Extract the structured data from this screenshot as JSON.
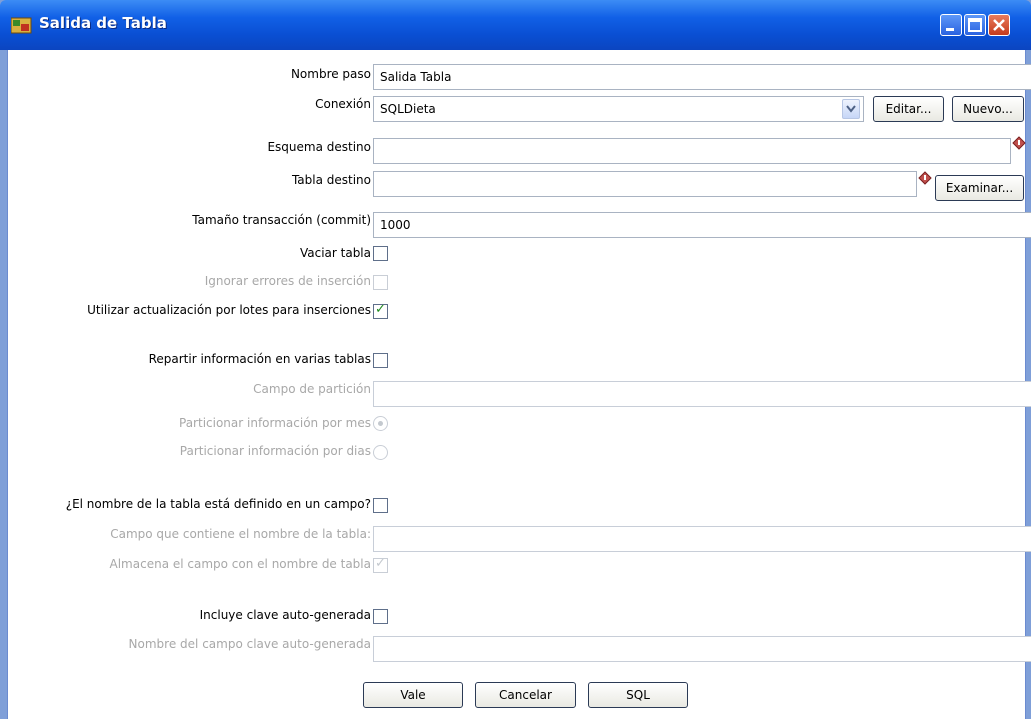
{
  "window": {
    "title": "Salida de Tabla"
  },
  "form": {
    "nombre_paso": {
      "label": "Nombre paso",
      "value": "Salida Tabla"
    },
    "conexion": {
      "label": "Conexión",
      "value": "SQLDieta",
      "edit_label": "Editar...",
      "new_label": "Nuevo..."
    },
    "esquema_destino": {
      "label": "Esquema destino",
      "value": ""
    },
    "tabla_destino": {
      "label": "Tabla destino",
      "value": "",
      "browse_label": "Examinar..."
    },
    "commit": {
      "label": "Tamaño transacción (commit)",
      "value": "1000"
    },
    "vaciar_tabla": {
      "label": "Vaciar tabla",
      "checked": false
    },
    "ignorar_errores": {
      "label": "Ignorar errores de inserción",
      "checked": false,
      "enabled": false
    },
    "batch": {
      "label": "Utilizar actualización por lotes para inserciones",
      "checked": true
    },
    "repartir": {
      "label": "Repartir información en varias tablas",
      "checked": false
    },
    "campo_particion": {
      "label": "Campo de partición",
      "value": "",
      "enabled": false
    },
    "por_mes": {
      "label": "Particionar información por mes",
      "selected": true,
      "enabled": false
    },
    "por_dias": {
      "label": "Particionar información por dias",
      "selected": false,
      "enabled": false
    },
    "nombre_en_campo": {
      "label": "¿El nombre de la tabla está definido en un campo?",
      "checked": false
    },
    "campo_nombre_tabla": {
      "label": "Campo que contiene el nombre de la tabla:",
      "value": "",
      "enabled": false
    },
    "almacena_campo": {
      "label": "Almacena el campo con el nombre de tabla",
      "checked": true,
      "enabled": false
    },
    "clave_auto": {
      "label": "Incluye clave auto-generada",
      "checked": false
    },
    "nombre_clave_auto": {
      "label": "Nombre del campo clave auto-generada",
      "value": "",
      "enabled": false
    }
  },
  "buttons": {
    "ok": "Vale",
    "cancel": "Cancelar",
    "sql": "SQL"
  },
  "colors": {
    "titlebar": "#0a4fd3",
    "checkmark": "#1f8c1f",
    "disabled_text": "#a8a8a8"
  }
}
